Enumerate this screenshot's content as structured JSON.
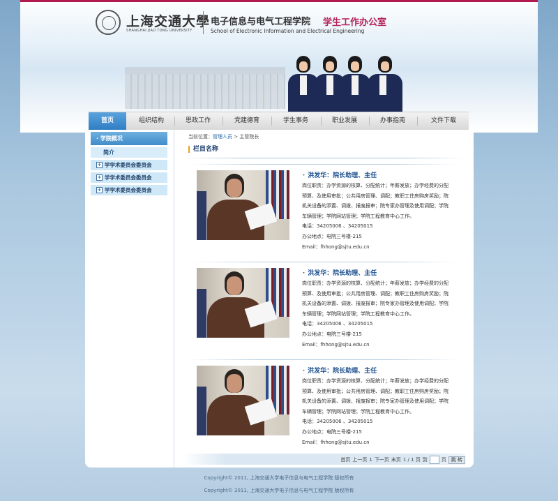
{
  "header": {
    "school_cn": "上海交通大學",
    "school_en": "SHANGHAI JIAO TONG UNIVERSITY",
    "dept_cn": "电子信息与电气工程学院",
    "dept_en": "School of Electronic Information and Electrical Engineering",
    "office": "学生工作办公室"
  },
  "nav": [
    "首页",
    "组织结构",
    "思政工作",
    "党建德育",
    "学生事务",
    "职业发展",
    "办事指南",
    "文件下载"
  ],
  "sidebar": {
    "heading": "· 学院概况",
    "sub": "简介",
    "items": [
      "学学术委员会委员会",
      "学学术委员会委员会",
      "学学术委员会委员会"
    ]
  },
  "breadcrumb": {
    "prefix": "当前位置：",
    "link": "管理人员",
    "separator": " > ",
    "current": "主管院长"
  },
  "column_title": "栏目名称",
  "people": [
    {
      "name": "洪发华：院长助理、主任",
      "duty": "岗位职责：办学资源的核算、分配统计；年薪发放；办学经费的分配预算、及使用审批；公共用房管理、调配；教职工住房购房奖励；院机关设备的添置、调拨、报废报审；院专家办管理及使用调配；学院车辆管理；学院网站管理；学院工程教育中心工作。",
      "phone": "电话：34205006 、34205015",
      "office": "办公地点：电院三号楼-215",
      "email": "Email：fhhong@sjtu.edu.cn"
    },
    {
      "name": "洪发华：院长助理、主任",
      "duty": "岗位职责：办学资源的核算、分配统计；年薪发放；办学经费的分配预算、及使用审批；公共用房管理、调配；教职工住房购房奖励；院机关设备的添置、调拨、报废报审；院专家办管理及使用调配；学院车辆管理；学院网站管理；学院工程教育中心工作。",
      "phone": "电话：34205006 、34205015",
      "office": "办公地点：电院三号楼-215",
      "email": "Email：fhhong@sjtu.edu.cn"
    },
    {
      "name": "洪发华：院长助理、主任",
      "duty": "岗位职责：办学资源的核算、分配统计；年薪发放；办学经费的分配预算、及使用审批；公共用房管理、调配；教职工住房购房奖励；院机关设备的添置、调拨、报废报审；院专家办管理及使用调配；学院车辆管理；学院网站管理；学院工程教育中心工作。",
      "phone": "电话：34205006 、34205015",
      "office": "办公地点：电院三号楼-215",
      "email": "Email：fhhong@sjtu.edu.cn"
    }
  ],
  "pager": {
    "first": "首页",
    "prev": "上一页",
    "page_num": "1",
    "next": "下一页",
    "last": "末页",
    "status": "1 / 1 页",
    "goto": "到",
    "page_unit": "页",
    "go_button": "跳 转"
  },
  "footer": {
    "line1": "Copyright© 2011, 上海交通大学电子信息与电气工程学院 版权所有",
    "line2": "Copyright© 2011, 上海交通大学电子信息与电气工程学院 版权所有"
  }
}
